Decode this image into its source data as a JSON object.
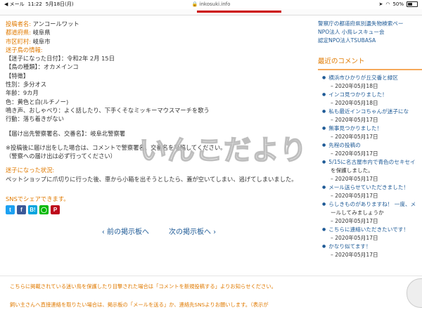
{
  "statusbar": {
    "app": "◀ メール",
    "time": "11:22",
    "date": "5月18日(月)",
    "url": "inkosuki.info",
    "battery": "50%"
  },
  "post": {
    "poster_label": "投稿者名:",
    "poster": "アンコールワット",
    "pref_label": "都道府県:",
    "pref": "岐阜県",
    "city_label": "市区町村:",
    "city": "岐阜市",
    "info_label": "迷子鳥の情報:",
    "lost_date": "【迷子になった日付】：令和2年 2月 15日",
    "species": "【鳥の種類】：オカメインコ",
    "features_label": "【特徴】",
    "sex": "性別：多分オス",
    "age": "年齢：9カ月",
    "color": "色：黄色と白(ルチノー)",
    "behavior": "鳴き声、おしゃべり：よく話したり、下手くそなミッキーマウスマーチを歌う",
    "action": "行動：落ち着きがない",
    "police": "【届け出先警察署名、交番名】：岐阜北警察署",
    "note1": "※投稿後に届け出をした場合は、コメントで警察署名、交番名を投稿してください。",
    "note2": "（警察への届け出は必ず行ってください）",
    "situation_label": "迷子になった状況:",
    "situation": "ペットショップに爪切りに行った後、車から小箱を出そうとしたら、蓋が空いてしまい、逃げてしまいました。"
  },
  "sns": {
    "label": "SNSでシェアできます。",
    "icons": [
      "twitter-icon",
      "facebook-icon",
      "hatena-icon",
      "line-icon",
      "pinterest-icon"
    ]
  },
  "nav": {
    "prev": "‹ 前の掲示板へ",
    "next": "次の掲示板へ ›"
  },
  "notice": {
    "line1": "こちらに掲載されている迷い鳥を保護したり目撃された場合は「コメントを新規投稿する」よりお知らせください。",
    "line2": "飼い主さんへ直接連絡を取りたい場合は、掲示板の「メールを送る」か、連絡先SNSよりお願いします。（表示が"
  },
  "watermark": "いんこだより",
  "sidebar": {
    "links": [
      "警察庁の都道府県別遺失物検索ペー",
      "NPO法人 小鳥レスキュー会",
      "認定NPO法人TSUBASA"
    ],
    "recent_title": "最近のコメント",
    "comments": [
      {
        "text": "横浜市ひかりが丘交番と緑区",
        "date": "– 2020年05月18日"
      },
      {
        "text": "インコ見つかりました！",
        "date": "– 2020年05月18日"
      },
      {
        "text": "私も最近インコちゃんが迷子にな",
        "date": "– 2020年05月17日"
      },
      {
        "text": "無事見つかりました！",
        "date": "– 2020年05月17日"
      },
      {
        "text": "先程の投稿の",
        "date": "– 2020年05月17日"
      },
      {
        "text": "5/15に名古屋市内で青色のセキセイ",
        "date": "を保護しました。"
      },
      {
        "text": "",
        "date": "– 2020年05月17日"
      },
      {
        "text": "メール送らせていただきました！",
        "date": "– 2020年05月17日"
      },
      {
        "text": "らしきものがありますね！ 一度、メ",
        "date": "ールしてみましょうか"
      },
      {
        "text": "",
        "date": "– 2020年05月17日"
      },
      {
        "text": "こちらに連絡いただきたいです！",
        "date": "– 2020年05月17日"
      },
      {
        "text": "かなり似てます！",
        "date": "– 2020年05月17日"
      }
    ]
  },
  "colors": {
    "accent": "#e07a00",
    "link": "#1e5a96"
  }
}
